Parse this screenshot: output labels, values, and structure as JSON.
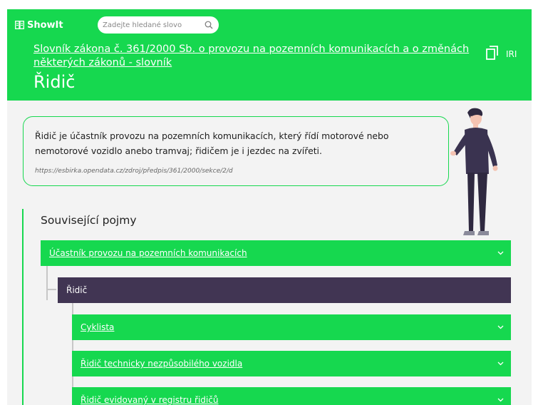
{
  "header": {
    "brand": "ShowIt",
    "search_placeholder": "Zadejte hledané slovo",
    "dictionary_link": "Slovník zákona č. 361/2000 Sb. o provozu na pozemních komunikacích a o změnách některých zákonů - slovník",
    "term": "Řidič",
    "iri_label": "IRI"
  },
  "definition": {
    "text": "Řidič je účastník provozu na pozemních komunikacích, který řídí motorové nebo nemotorové vozidlo anebo tramvaj; řidičem je i jezdec na zvířeti.",
    "source": "https://esbirka.opendata.cz/zdroj/předpis/361/2000/sekce/2/d"
  },
  "related": {
    "title": "Související pojmy",
    "items": [
      {
        "label": "Účastník provozu na pozemních komunikacích",
        "kind": "parent"
      },
      {
        "label": "Řidič",
        "kind": "current"
      },
      {
        "label": "Cyklista",
        "kind": "child"
      },
      {
        "label": "Řidič technicky nezpůsobilého vozidla",
        "kind": "child"
      },
      {
        "label": "Řidič evidovaný v registru řidičů",
        "kind": "child"
      }
    ]
  },
  "colors": {
    "accent_green": "#16d84f",
    "current_item": "#413553",
    "page_background": "#f3f3f3"
  }
}
